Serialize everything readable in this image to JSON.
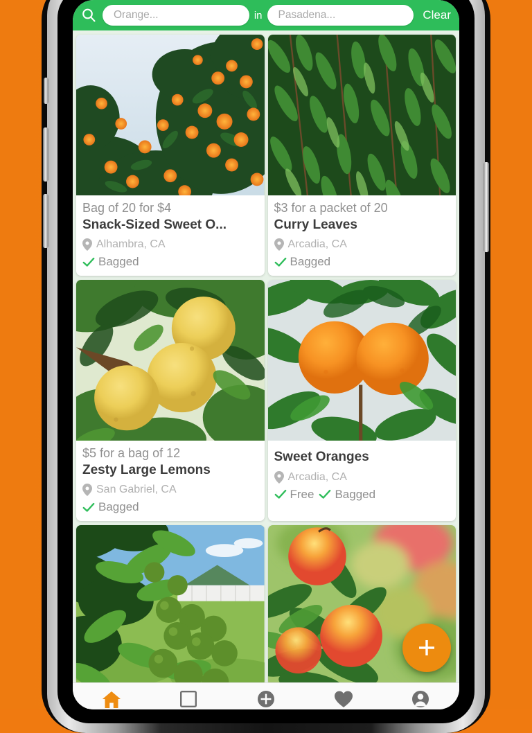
{
  "search": {
    "search_icon": "search-icon",
    "what_placeholder": "Orange...",
    "what_value": "",
    "in_label": "in",
    "where_placeholder": "Pasadena...",
    "where_value": "",
    "clear_label": "Clear",
    "bar_color": "#2EBD5A"
  },
  "feed": {
    "background_color": "#E7F2E7",
    "cards": [
      {
        "price": "Bag of 20 for $4",
        "title": "Snack-Sized Sweet O...",
        "location": "Alhambra, CA",
        "tags": [
          "Bagged"
        ],
        "photo": "orange-tree-kumquats"
      },
      {
        "price": "$3 for a packet of 20",
        "title": "Curry Leaves",
        "location": "Arcadia, CA",
        "tags": [
          "Bagged"
        ],
        "photo": "curry-leaves"
      },
      {
        "price": "$5 for a bag of 12",
        "title": "Zesty Large Lemons",
        "location": "San Gabriel, CA",
        "tags": [
          "Bagged"
        ],
        "photo": "lemons-on-tree"
      },
      {
        "price": "",
        "title": "Sweet Oranges",
        "location": "Arcadia, CA",
        "tags": [
          "Free",
          "Bagged"
        ],
        "photo": "two-oranges"
      },
      {
        "price": "",
        "title": "",
        "location": "",
        "tags": [],
        "photo": "green-limes-yard"
      },
      {
        "price": "",
        "title": "",
        "location": "",
        "tags": [],
        "photo": "peaches-on-branch"
      }
    ]
  },
  "fab": {
    "label": "+",
    "name": "add-listing-fab",
    "color": "#ED8B0F"
  },
  "bottom_nav": {
    "active_color": "#EE8C11",
    "inactive_color": "#757575",
    "items": [
      {
        "icon": "home-icon",
        "active": true
      },
      {
        "icon": "square-icon",
        "active": false
      },
      {
        "icon": "plus-circle-icon",
        "active": false
      },
      {
        "icon": "heart-icon",
        "active": false
      },
      {
        "icon": "person-icon",
        "active": false
      }
    ]
  },
  "device": {
    "body_color": "#0a0a0a",
    "backdrop_color": "#F07A0F"
  }
}
